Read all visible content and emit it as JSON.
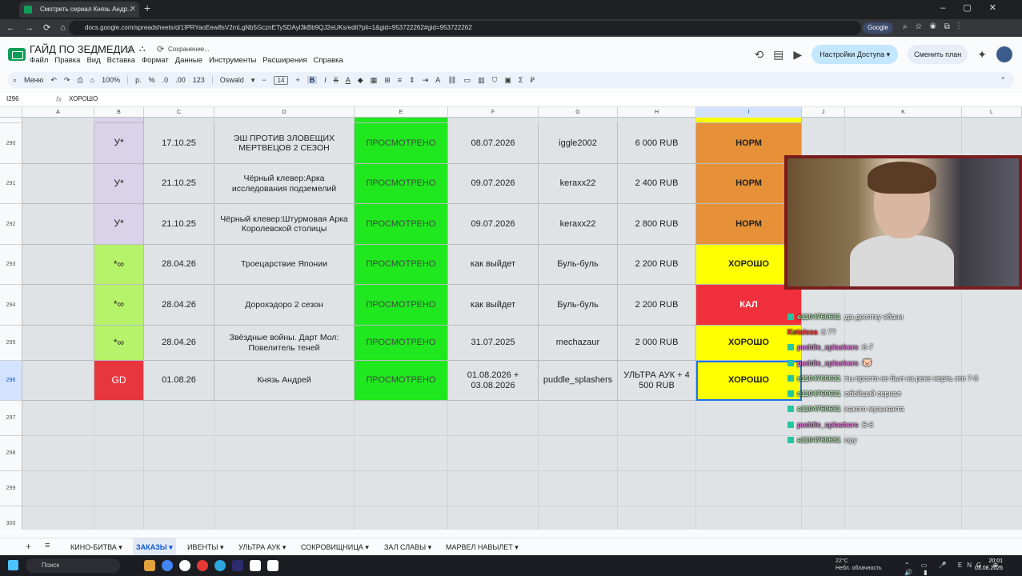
{
  "browser": {
    "tab_title": "Смотреть сериал Князь Андр...",
    "url": "docs.google.com/spreadsheets/d/1IPRYaoEew8sV2mLgNb5GcznETySDAyl3kBb9QJ2eUKs/edit?pli=1&gid=953722262#gid=953722262",
    "google_pill": "Google"
  },
  "doc": {
    "title": "ГАЙД ПО ЗЕДМЕДИА",
    "saving_status": "Сохранение...",
    "menu": [
      "Файл",
      "Правка",
      "Вид",
      "Вставка",
      "Формат",
      "Данные",
      "Инструменты",
      "Расширения",
      "Справка"
    ],
    "share_label": "Настройки Доступа",
    "plan_label": "Сменить план"
  },
  "toolbar": {
    "menu_label": "Меню",
    "zoom": "100%",
    "currency": "р.",
    "percent": "%",
    "dec_less": ".0",
    "dec_more": ".00",
    "number_format": "123",
    "font": "Oswald",
    "font_size": "14"
  },
  "formula": {
    "cell_ref": "I296",
    "value": "ХОРОШО"
  },
  "columns": [
    "A",
    "B",
    "C",
    "D",
    "E",
    "F",
    "G",
    "H",
    "I",
    "J",
    "K",
    "L"
  ],
  "rows": [
    {
      "num": "290",
      "b": "У*",
      "b_color": "#d9d2e9",
      "date": "17.10.25",
      "title": "ЭШ ПРОТИВ ЗЛОВЕЩИХ МЕРТВЕЦОВ 2 СЕЗОН",
      "status": "ПРОСМОТРЕНО",
      "watch": "08.07.2026",
      "user": "iggle2002",
      "price": "6 000 RUB",
      "rating": "НОРМ",
      "rating_color": "#e69138"
    },
    {
      "num": "291",
      "b": "У*",
      "b_color": "#d9d2e9",
      "date": "21.10.25",
      "title": "Чёрный клевер:Арка исследования подземелий",
      "status": "ПРОСМОТРЕНО",
      "watch": "09.07.2026",
      "user": "keraxx22",
      "price": "2 400 RUB",
      "rating": "НОРМ",
      "rating_color": "#e69138"
    },
    {
      "num": "292",
      "b": "У*",
      "b_color": "#d9d2e9",
      "date": "21.10.25",
      "title": "Чёрный клевер:Штурмовая Арка Королевской столицы",
      "status": "ПРОСМОТРЕНО",
      "watch": "09.07.2026",
      "user": "keraxx22",
      "price": "2 800 RUB",
      "rating": "НОРМ",
      "rating_color": "#e69138"
    },
    {
      "num": "293",
      "b": "*∞",
      "b_color": "#b6f36a",
      "date": "28.04.26",
      "title": "Троецарствие Японии",
      "status": "ПРОСМОТРЕНО",
      "watch": "как выйдет",
      "user": "Буль-буль",
      "price": "2 200 RUB",
      "rating": "ХОРОШО",
      "rating_color": "#ffff00"
    },
    {
      "num": "294",
      "b": "*∞",
      "b_color": "#b6f36a",
      "date": "28.04.26",
      "title": "Дорохэдоро 2 сезон",
      "status": "ПРОСМОТРЕНО",
      "watch": "как выйдет",
      "user": "Буль-буль",
      "price": "2 200 RUB",
      "rating": "КАЛ",
      "rating_color": "#f0303b"
    },
    {
      "num": "295",
      "b": "*∞",
      "b_color": "#b6f36a",
      "date": "28.04.26",
      "title": "Звёздные войны. Дарт Мол: Повелитель теней",
      "status": "ПРОСМОТРЕНО",
      "watch": "31.07.2025",
      "user": "mechazaur",
      "price": "2 000 RUB",
      "rating": "ХОРОШО",
      "rating_color": "#ffff00"
    },
    {
      "num": "296",
      "b": "GD",
      "b_color": "#e8363f",
      "date": "01.08.26",
      "title": "Князь Андрей",
      "status": "ПРОСМОТРЕНО",
      "watch": "01.08.2026 + 03.08.2026",
      "user": "puddle_splashers",
      "price": "УЛЬТРА АУК + 4 500 RUB",
      "rating": "ХОРОШО",
      "rating_color": "#ffff00"
    }
  ],
  "empty_rows": [
    "297",
    "298",
    "299",
    "300"
  ],
  "chat": [
    {
      "user": "e1104760631",
      "text": "да десятку ебани",
      "user_color": "#a3e6a0"
    },
    {
      "user": "Kotaissa",
      "text": "6 7?",
      "user_color": "#e8433f"
    },
    {
      "user": "puddle_splashers",
      "text": "6-7",
      "user_color": "#e07bd6"
    },
    {
      "user": "puddle_splashers",
      "text": "🐷",
      "user_color": "#e07bd6"
    },
    {
      "user": "e1104760631",
      "text": "ты просто не был на реке нерль это 7-8",
      "user_color": "#a3e6a0"
    },
    {
      "user": "e1104760631",
      "text": "обейший сериал",
      "user_color": "#a3e6a0"
    },
    {
      "user": "e1104760631",
      "text": "какого музыканта",
      "user_color": "#a3e6a0"
    },
    {
      "user": "puddle_splashers",
      "text": "5-6",
      "user_color": "#e07bd6"
    },
    {
      "user": "e1104760631",
      "text": "ору",
      "user_color": "#a3e6a0"
    }
  ],
  "sheets": [
    "КИНО-БИТВА",
    "ЗАКАЗЫ",
    "ИВЕНТЫ",
    "УЛЬТРА АУК",
    "СОКРОВИЩНИЦА",
    "ЗАЛ СЛАВЫ",
    "МАРВЕЛ НАВЫЛЕТ"
  ],
  "active_sheet": "ЗАКАЗЫ",
  "taskbar": {
    "search": "Поиск",
    "temp": "22°C",
    "weather": "Небл. облачность",
    "lang": "ENG",
    "time": "20:01",
    "date": "03.08.2026"
  }
}
